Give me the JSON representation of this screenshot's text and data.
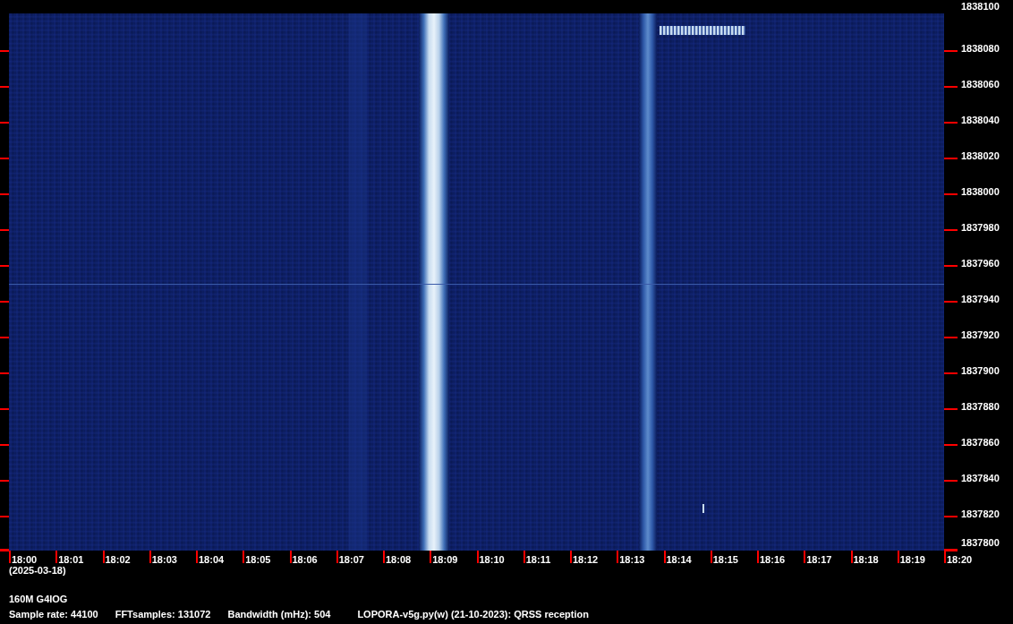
{
  "frequency_axis": {
    "labels": [
      "1838100",
      "1838080",
      "1838060",
      "1838040",
      "1838020",
      "1838000",
      "1837980",
      "1837960",
      "1837940",
      "1837920",
      "1837900",
      "1837880",
      "1837860",
      "1837840",
      "1837820",
      "1837800"
    ]
  },
  "time_axis": {
    "labels": [
      "18:00",
      "18:01",
      "18:02",
      "18:03",
      "18:04",
      "18:05",
      "18:06",
      "18:07",
      "18:08",
      "18:09",
      "18:10",
      "18:11",
      "18:12",
      "18:13",
      "18:14",
      "18:15",
      "18:16",
      "18:17",
      "18:18",
      "18:19",
      "18:20"
    ],
    "date": "(2025-03-18)"
  },
  "station": "160M G4IOG",
  "info": [
    "Sample rate: 44100",
    "FFTsamples: 131072",
    "Bandwidth (mHz): 504",
    "LOPORA-v5g.py(w) (21-10-2023): QRSS reception"
  ]
}
